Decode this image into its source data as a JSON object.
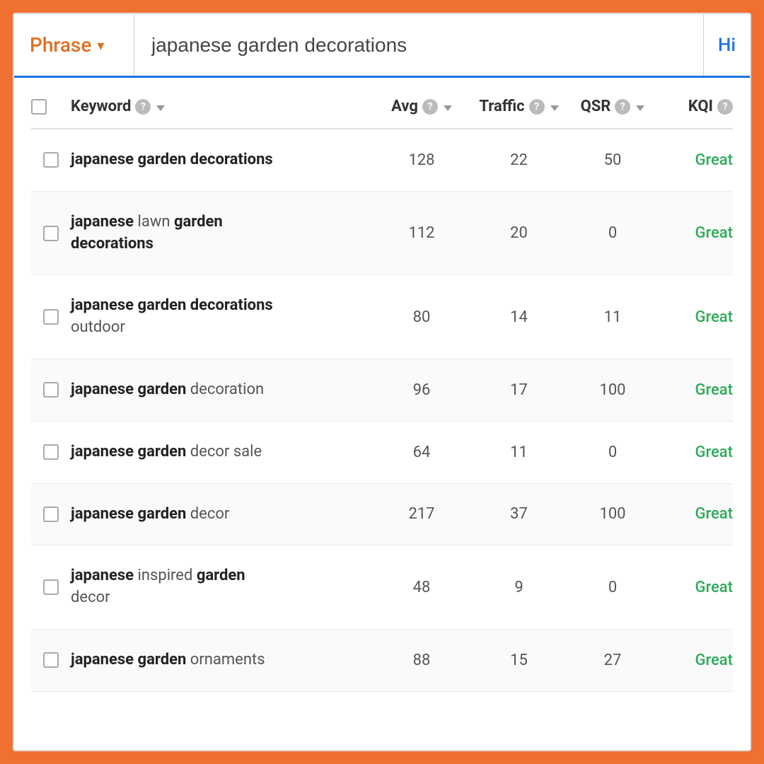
{
  "header": {
    "phrase_label": "Phrase",
    "chevron": "▾",
    "search_value": "japanese garden decorations",
    "hi_label": "Hi"
  },
  "table": {
    "columns": [
      {
        "id": "keyword",
        "label": "Keyword",
        "has_info": true,
        "has_sort": true
      },
      {
        "id": "avg",
        "label": "Avg",
        "has_info": true,
        "has_sort": true
      },
      {
        "id": "traffic",
        "label": "Traffic",
        "has_info": true,
        "has_sort": true
      },
      {
        "id": "qsr",
        "label": "QSR",
        "has_info": true,
        "has_sort": true
      },
      {
        "id": "kqi",
        "label": "KQI",
        "has_info": true,
        "has_sort": false
      }
    ],
    "rows": [
      {
        "keyword_bold": "japanese garden decorations",
        "keyword_normal": "",
        "keyword_display": "japanese garden decorations",
        "avg": "128",
        "traffic": "22",
        "qsr": "50",
        "kqi": "Great"
      },
      {
        "keyword_bold": "japanese",
        "keyword_bold2": "garden",
        "keyword_normal_mid": " lawn ",
        "keyword_normal_end": "",
        "keyword_line2": "decorations",
        "keyword_line2_bold": true,
        "keyword_display": "japanese lawn garden decorations",
        "avg": "112",
        "traffic": "20",
        "qsr": "0",
        "kqi": "Great"
      },
      {
        "keyword_display": "japanese garden decorations outdoor",
        "keyword_bold_part": "japanese garden decorations",
        "keyword_normal_part": " outdoor",
        "avg": "80",
        "traffic": "14",
        "qsr": "11",
        "kqi": "Great"
      },
      {
        "keyword_display": "japanese garden decoration",
        "keyword_bold_part": "japanese garden",
        "keyword_normal_part": " decoration",
        "avg": "96",
        "traffic": "17",
        "qsr": "100",
        "kqi": "Great"
      },
      {
        "keyword_display": "japanese garden decor sale",
        "keyword_bold_part": "japanese garden",
        "keyword_normal_part": " decor sale",
        "avg": "64",
        "traffic": "11",
        "qsr": "0",
        "kqi": "Great"
      },
      {
        "keyword_display": "japanese garden decor",
        "keyword_bold_part": "japanese garden",
        "keyword_normal_part": " decor",
        "avg": "217",
        "traffic": "37",
        "qsr": "100",
        "kqi": "Great"
      },
      {
        "keyword_display": "japanese inspired garden decor",
        "keyword_bold_part": "japanese",
        "keyword_bold_part2": "garden",
        "keyword_normal_part": " inspired ",
        "keyword_normal_end": " decor",
        "avg": "48",
        "traffic": "9",
        "qsr": "0",
        "kqi": "Great"
      },
      {
        "keyword_display": "japanese garden ornaments",
        "keyword_bold_part": "japanese garden",
        "keyword_normal_part": " ornaments",
        "avg": "88",
        "traffic": "15",
        "qsr": "27",
        "kqi": "Great"
      }
    ]
  },
  "icons": {
    "info": "?",
    "chevron_down": "▾",
    "checkbox_empty": ""
  }
}
